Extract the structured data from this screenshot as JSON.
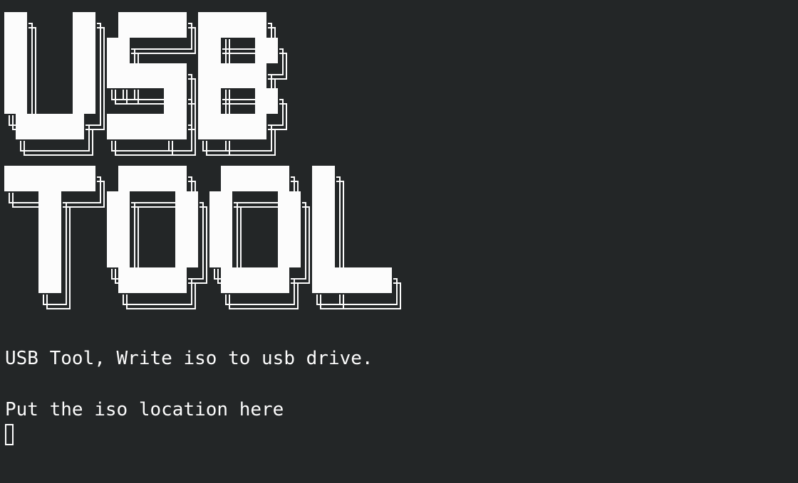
{
  "terminal": {
    "banner_text": "USB TOOL",
    "banner_line_1": "USB",
    "banner_line_2": "TOOL",
    "description": "USB Tool, Write iso to usb drive.",
    "prompt": "Put the iso location here",
    "input_value": "",
    "colors": {
      "background": "#232627",
      "foreground": "#fcfcfc"
    }
  }
}
